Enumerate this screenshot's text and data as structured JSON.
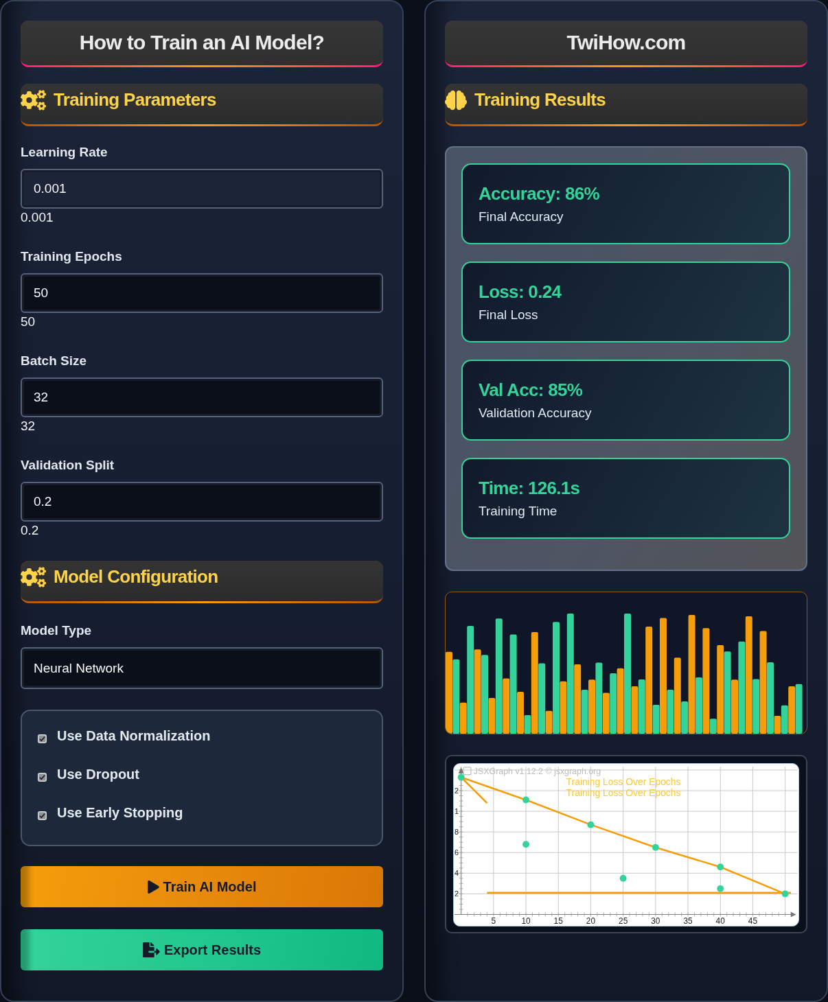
{
  "left_panel": {
    "title": "How to Train an AI Model?",
    "parameters": {
      "heading": "Training Parameters",
      "fields": [
        {
          "kind": "number",
          "label": "Learning Rate",
          "value": "0.001",
          "reading": "0.001",
          "focused": true
        },
        {
          "kind": "number",
          "label": "Training Epochs",
          "value": "50",
          "reading": "50",
          "focused": false
        },
        {
          "kind": "number",
          "label": "Batch Size",
          "value": "32",
          "reading": "32",
          "focused": false
        },
        {
          "kind": "number",
          "label": "Validation Split",
          "value": "0.2",
          "reading": "0.2",
          "focused": false
        }
      ]
    },
    "configuration": {
      "heading": "Model Configuration",
      "fields": [
        {
          "kind": "select",
          "label": "Model Type",
          "value": "Neural Network",
          "focused": false
        }
      ],
      "options": [
        {
          "label": "Use Data Normalization",
          "checked": true
        },
        {
          "label": "Use Dropout",
          "checked": true
        },
        {
          "label": "Use Early Stopping",
          "checked": true
        }
      ]
    },
    "buttons": [
      {
        "kind": "train",
        "label": "Train AI Model"
      },
      {
        "kind": "export",
        "label": "Export Results"
      }
    ]
  },
  "right_panel": {
    "title": "TwiHow.com",
    "heading": "Training Results",
    "results": [
      {
        "title": "Accuracy: 86%",
        "caption": "Final Accuracy"
      },
      {
        "title": "Loss: 0.24",
        "caption": "Final Loss"
      },
      {
        "title": "Val Acc: 85%",
        "caption": "Validation Accuracy"
      },
      {
        "title": "Time: 126.1s",
        "caption": "Training Time"
      }
    ],
    "loss_chart": {
      "copyright": "JSXGraph v1.12.2 © jsxgraph.org",
      "titles": [
        "Training Loss Over Epochs",
        "Training Loss Over Epochs"
      ],
      "y_tick_labels": [
        "2",
        "1",
        "8",
        "6",
        "4",
        "2"
      ],
      "x_tick_labels": [
        "5",
        "10",
        "15",
        "20",
        "25",
        "30",
        "35",
        "40",
        "45"
      ]
    }
  }
}
